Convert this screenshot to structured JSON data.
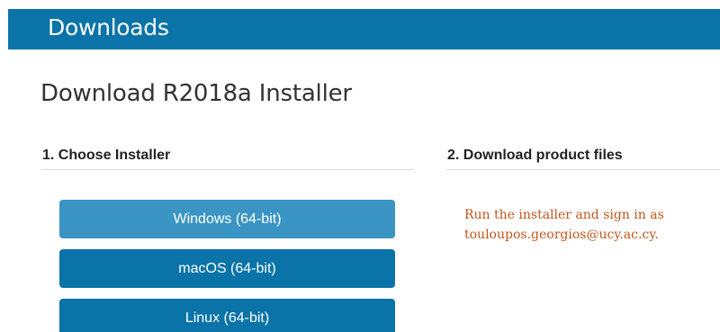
{
  "header": {
    "title": "Downloads",
    "bar_color": "#0a74a8"
  },
  "main": {
    "title": "Download R2018a Installer",
    "step1": {
      "heading": "1. Choose Installer",
      "buttons": [
        {
          "label": "Windows (64-bit)",
          "selected": true
        },
        {
          "label": "macOS (64-bit)",
          "selected": false
        },
        {
          "label": "Linux (64-bit)",
          "selected": false
        }
      ]
    },
    "step2": {
      "heading": "2. Download product files",
      "message_line1": "Run the installer and sign in as",
      "message_line2": "touloupos.georgios@ucy.ac.cy.",
      "message_color": "#c1561c"
    }
  }
}
